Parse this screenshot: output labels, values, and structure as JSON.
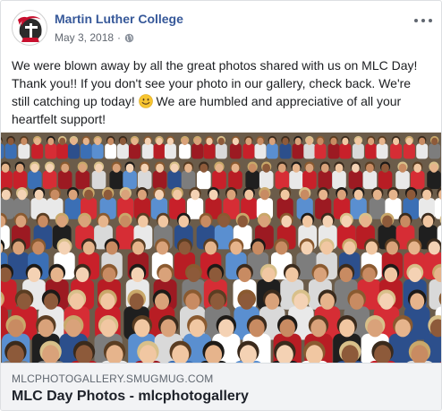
{
  "page": {
    "name": "Martin Luther College",
    "date": "May 3, 2018",
    "separator": "·",
    "privacy_icon": "globe-icon",
    "menu_icon": "more-options-icon"
  },
  "post": {
    "text_part1": "We were blown away by all the great photos shared with us on MLC Day! Thank you!! If you don't see your photo in our gallery, check back. We're still catching up today! ",
    "emoji": "smiling-face-emoji",
    "text_part2": " We are humbled and appreciative of all your heartfelt support!"
  },
  "link": {
    "domain": "MLCPHOTOGALLERY.SMUGMUG.COM",
    "title": "MLC Day Photos - mlcphotogallery"
  },
  "colors": {
    "page_name": "#365899",
    "meta": "#616770",
    "link_bg": "#f2f3f5",
    "logo_red": "#c8102e"
  }
}
